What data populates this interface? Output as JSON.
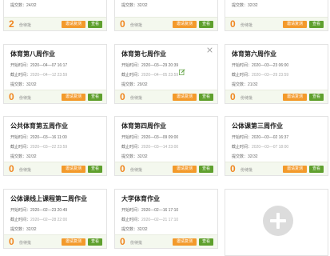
{
  "labels": {
    "start": "开始时间：",
    "end": "截止时间：",
    "submitted": "提交数：",
    "pending": "份待批",
    "remind": "邀请复测",
    "view": "查看"
  },
  "top_cards": [
    {
      "submitted": "24/32",
      "pending": "2"
    },
    {
      "submitted": "32/32",
      "pending": "0"
    },
    {
      "submitted": "32/32",
      "pending": "0"
    }
  ],
  "cards": [
    {
      "title": "体育第八周作业",
      "start": "2020—04—07 16:17",
      "end": "2020—04—12 23:59",
      "submitted": "32/32",
      "pending": "0"
    },
    {
      "title": "体育第七周作业",
      "start": "2020—03—29 20:39",
      "end": "2020—04—05 23:59",
      "submitted": "29/32",
      "pending": "0"
    },
    {
      "title": "体育第六周作业",
      "start": "2020—03—23 06:00",
      "end": "2020—03—29 23:59",
      "submitted": "21/32",
      "pending": "0"
    },
    {
      "title": "公共体育第五周作业",
      "start": "2020—03—16 11:00",
      "end": "2020—03—22 23:59",
      "submitted": "32/32",
      "pending": "0"
    },
    {
      "title": "体育第四周作业",
      "start": "2020—03—09 09:00",
      "end": "2020—03—14 23:00",
      "submitted": "32/32",
      "pending": "0"
    },
    {
      "title": "公体课第三周作业",
      "start": "2020—03—02 16:37",
      "end": "2020—03—07 18:00",
      "submitted": "32/32",
      "pending": "0"
    },
    {
      "title": "公体课线上课程第二周作业",
      "start": "2020—02—23 20:49",
      "end": "2020—02—28 22:00",
      "submitted": "32/32",
      "pending": "0"
    },
    {
      "title": "大学体育作业",
      "start": "2020—02—16 17:10",
      "end": "2020—02—21 17:10",
      "submitted": "32/32",
      "pending": "0"
    }
  ],
  "colors": {
    "pending_count": "#f0861f",
    "remind_button": "#f39a2b",
    "view_button": "#5fa02d",
    "footer_bg": "#f4f8ee",
    "edit_icon": "#6aa84f"
  },
  "icons": {
    "close": "close-icon",
    "edit": "edit-icon",
    "add": "add-icon"
  }
}
